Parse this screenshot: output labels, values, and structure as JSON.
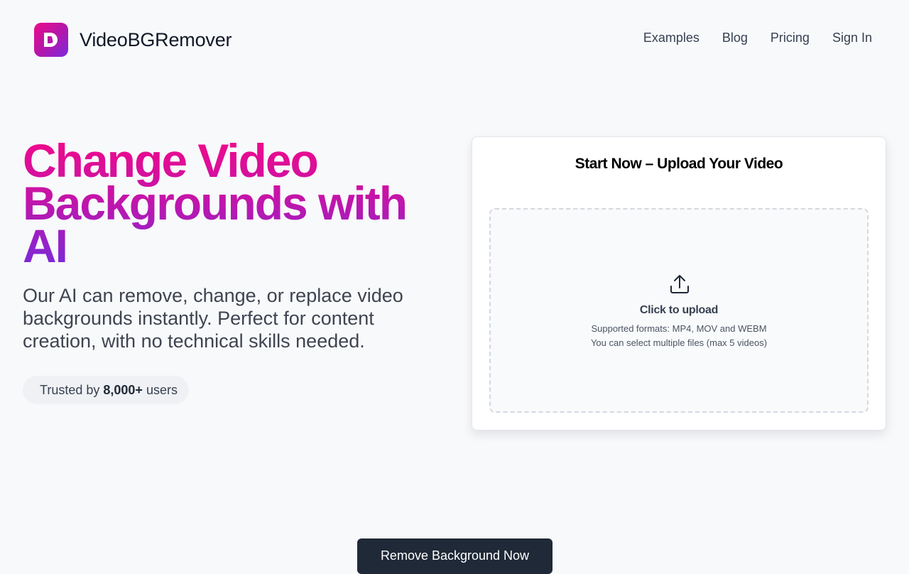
{
  "header": {
    "brand": "VideoBGRemover",
    "logo_icon": "logo-d-icon",
    "nav": [
      "Examples",
      "Blog",
      "Pricing",
      "Sign In"
    ]
  },
  "hero": {
    "title_line1": "Change Video",
    "title_line2": "Backgrounds with",
    "title_line3": "AI",
    "subtitle": "Our AI can remove, change, or replace video backgrounds instantly. Perfect for content creation, with no technical skills needed.",
    "trust": {
      "prefix": "Trusted by",
      "count": "8,000+",
      "suffix": "users"
    }
  },
  "upload_card": {
    "title": "Start Now – Upload Your Video",
    "icon": "upload-icon",
    "main": "Click to upload",
    "formats": "Supported formats: MP4, MOV and WEBM",
    "multi": "You can select multiple files (max 5 videos)"
  },
  "cta": {
    "label": "Remove Background Now"
  },
  "colors": {
    "accent_pink": "#ec0b8a",
    "accent_purple": "#7c2ae0",
    "cta_bg": "#1f2937",
    "page_bg": "#f8f9fb"
  }
}
